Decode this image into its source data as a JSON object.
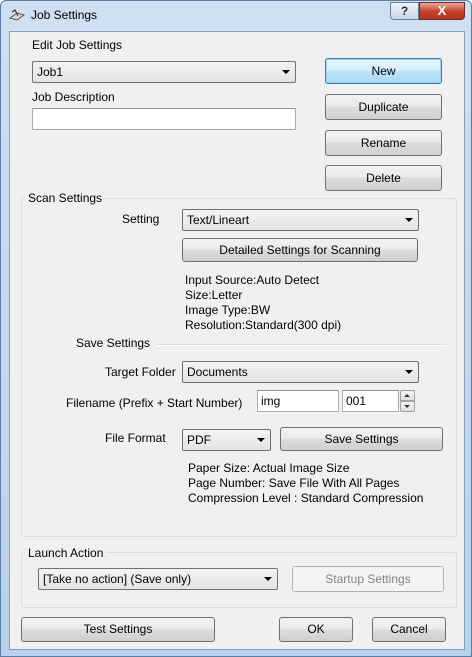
{
  "window": {
    "title": "Job Settings",
    "help_label": "?",
    "close_label": "X"
  },
  "job": {
    "edit_label": "Edit Job Settings",
    "selected_job": "Job1",
    "description_label": "Job Description",
    "description_value": "",
    "new_label": "New",
    "duplicate_label": "Duplicate",
    "rename_label": "Rename",
    "delete_label": "Delete"
  },
  "scan": {
    "group_label": "Scan Settings",
    "setting_label": "Setting",
    "setting_value": "Text/Lineart",
    "detailed_button": "Detailed Settings for Scanning",
    "info": [
      "Input Source:Auto Detect",
      "Size:Letter",
      "Image Type:BW",
      "Resolution:Standard(300 dpi)"
    ]
  },
  "save": {
    "section_label": "Save Settings",
    "target_folder_label": "Target Folder",
    "target_folder_value": "Documents",
    "filename_label": "Filename (Prefix + Start Number)",
    "prefix_value": "img",
    "start_number_value": "001",
    "file_format_label": "File Format",
    "file_format_value": "PDF",
    "save_settings_button": "Save Settings",
    "info": [
      "Paper Size: Actual Image Size",
      "Page Number: Save File With All Pages",
      "Compression Level : Standard Compression"
    ]
  },
  "launch": {
    "group_label": "Launch Action",
    "action_value": "[Take no action] (Save only)",
    "startup_button": "Startup Settings"
  },
  "footer": {
    "test_label": "Test Settings",
    "ok_label": "OK",
    "cancel_label": "Cancel"
  }
}
